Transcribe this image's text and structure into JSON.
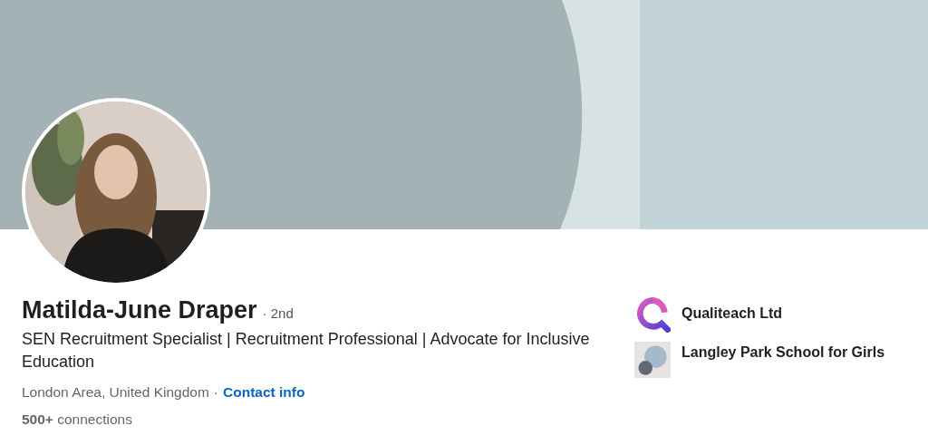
{
  "profile": {
    "name": "Matilda-June Draper",
    "degree": "· 2nd",
    "headline": "SEN Recruitment Specialist | Recruitment Professional | Advocate for Inclusive Education",
    "location": "London Area, United Kingdom",
    "separator": "·",
    "contact_link": "Contact info",
    "connections": "**500+** connections"
  },
  "organizations": [
    {
      "kind": "company",
      "name": "Qualiteach Ltd"
    },
    {
      "kind": "school",
      "name": "Langley Park School for Girls"
    }
  ]
}
